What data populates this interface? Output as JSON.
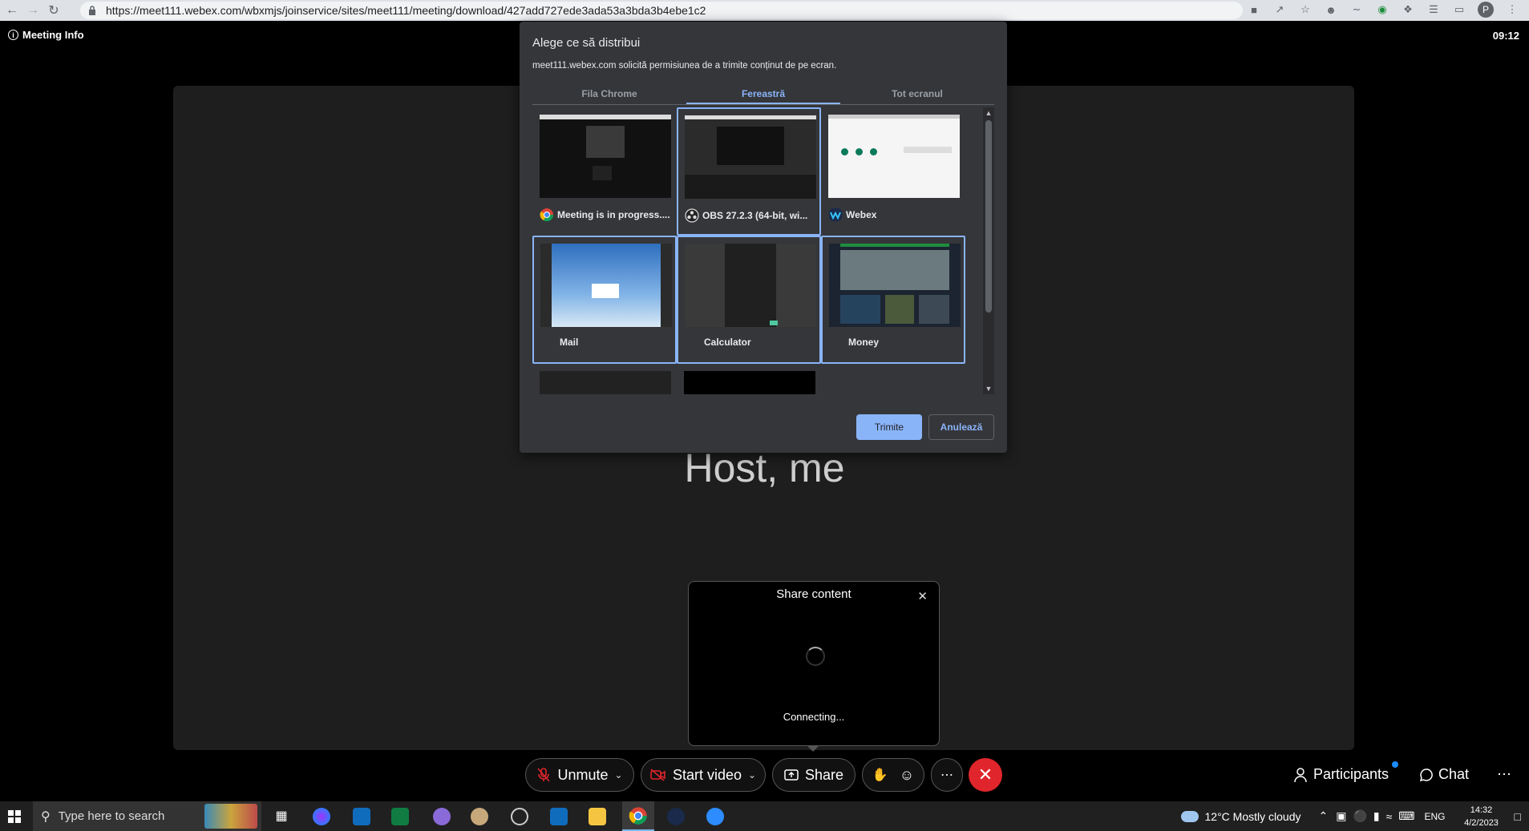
{
  "browser": {
    "url": "https://meet111.webex.com/wbxmjs/joinservice/sites/meet111/meeting/download/427add727ede3ada53a3bda3b4ebe1c2",
    "profile_initial": "P"
  },
  "meeting": {
    "info_label": "Meeting Info",
    "elapsed": "09:12",
    "host_name": "Host, me"
  },
  "dialog": {
    "title": "Alege ce să distribui",
    "subtitle": "meet111.webex.com solicită permisiunea de a trimite conținut de pe ecran.",
    "tabs": [
      "Fila Chrome",
      "Fereastră",
      "Tot ecranul"
    ],
    "active_tab": "Fereastră",
    "tiles": [
      {
        "label": "Meeting is in progress....",
        "icon": "chrome-icon"
      },
      {
        "label": "OBS 27.2.3 (64-bit, wi...",
        "icon": "obs-icon"
      },
      {
        "label": "Webex",
        "icon": "webex-icon"
      },
      {
        "label": "Mail",
        "icon": ""
      },
      {
        "label": "Calculator",
        "icon": ""
      },
      {
        "label": "Money",
        "icon": ""
      }
    ],
    "send_label": "Trimite",
    "cancel_label": "Anulează"
  },
  "share_popup": {
    "title": "Share content",
    "status": "Connecting..."
  },
  "toolbar": {
    "unmute": "Unmute",
    "start_video": "Start video",
    "share": "Share",
    "participants": "Participants",
    "chat": "Chat",
    "end_color": "#e0262c"
  },
  "taskbar": {
    "search_placeholder": "Type here to search",
    "weather": "12°C  Mostly cloudy",
    "language": "ENG",
    "time": "14:32",
    "date": "4/2/2023"
  }
}
